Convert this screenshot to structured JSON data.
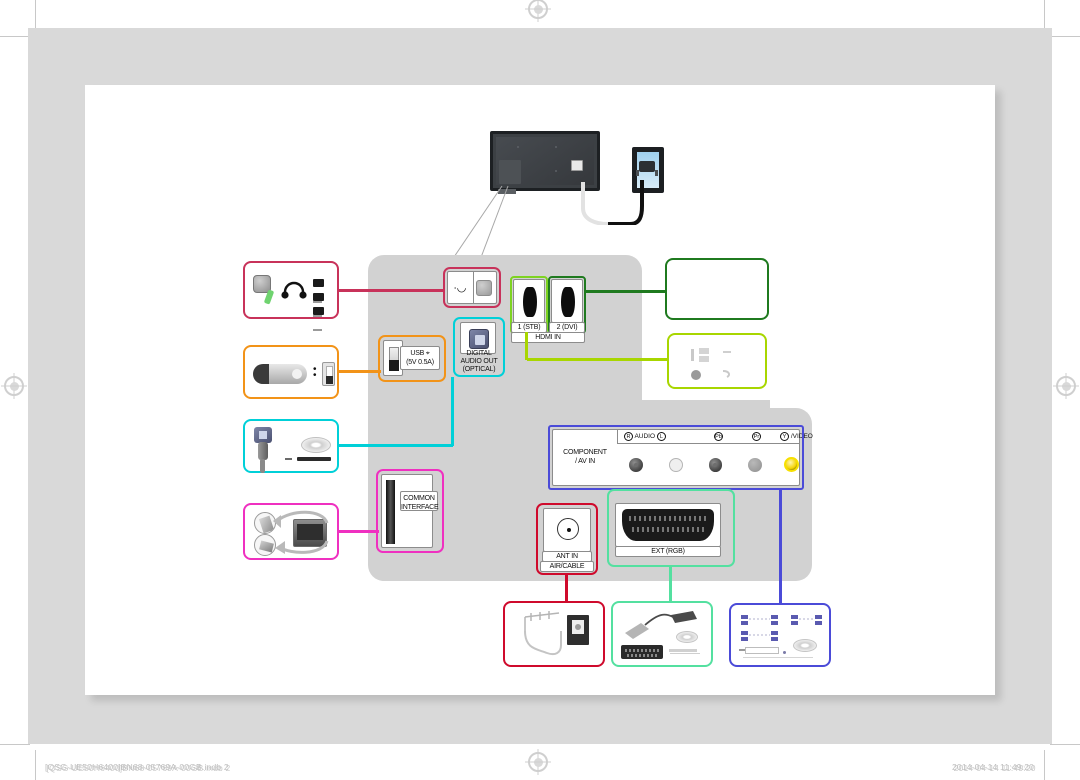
{
  "document": {
    "type": "tv-connection-guide",
    "footer_left": "[QSG-UE50H6400]BN68-05769A-00GB.indb   2",
    "footer_page": "2",
    "footer_right": "2014-04-14   11:49:20"
  },
  "panel_labels": {
    "hdmi_in": "HDMI IN",
    "hdmi_1": "1 (STB)",
    "hdmi_2": "2 (DVI)",
    "usb": "USB",
    "usb_spec": "(5V 0.5A)",
    "digital_audio_out": "DIGITAL",
    "digital_audio_out_2": "AUDIO OUT",
    "digital_audio_out_3": "(OPTICAL)",
    "common_interface": "COMMON",
    "common_interface_2": "INTERFACE",
    "ant_in": "ANT IN",
    "ant_in_2": "AIR/CABLE",
    "ext_rgb": "EXT (RGB)",
    "component_av_in": "COMPONENT",
    "component_av_in_2": "/ AV IN"
  },
  "av_header": {
    "audio_r": "R",
    "audio_text": "AUDIO",
    "audio_l": "L",
    "pb": "Pb",
    "pr": "Pr",
    "y": "Y",
    "video": "/VIDEO"
  },
  "highlight_colors": {
    "headphone": "#c8325a",
    "usb": "#f29318",
    "optical": "#00d0d8",
    "common_interface": "#ef30c0",
    "hdmi_1": "#7ed321",
    "hdmi_2": "#1f7a1f",
    "component": "#4b4bd8",
    "ant": "#cf0a2c",
    "scart": "#54e0a0",
    "device_hdmi_dark": "#1f7a1f",
    "device_hdmi_light": "#a8d600"
  },
  "icons": {
    "registration_mark": "registration-target-icon",
    "headphone": "headphone-icon",
    "usb_drive": "usb-flash-drive-icon",
    "optical_cable": "optical-cable-icon",
    "ci_card": "ci-card-insert-icon",
    "antenna": "antenna-wall-jack-icon",
    "scart_cable": "scart-cable-icon",
    "rca_cable": "rca-cable-icon",
    "hdmi_cable": "hdmi-cable-icon",
    "tv_rear": "tv-rear-icon",
    "wall_outlet": "wall-outlet-icon"
  }
}
